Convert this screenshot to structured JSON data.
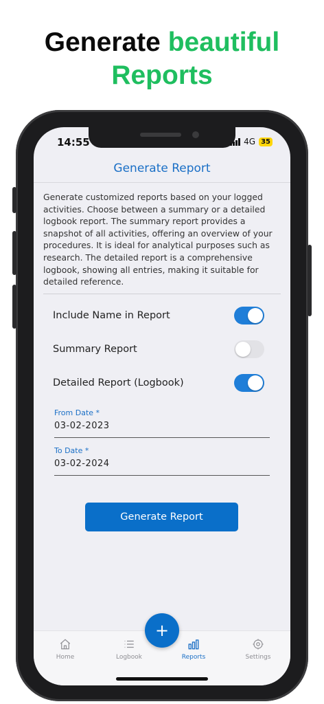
{
  "headline": {
    "line1_dark": "Generate",
    "line1_accent": "beautiful",
    "line2_accent": "Reports"
  },
  "status": {
    "time": "14:55",
    "network": "4G",
    "battery": "35"
  },
  "header": {
    "title": "Generate Report"
  },
  "description": "Generate customized reports based on your logged activities. Choose between a summary or a detailed logbook report. The summary report provides a snapshot of all activities, offering an overview of your procedures. It is ideal for analytical purposes such as research. The detailed report is a comprehensive logbook, showing all entries, making it suitable for detailed reference.",
  "toggles": [
    {
      "label": "Include Name in Report",
      "on": true
    },
    {
      "label": "Summary Report",
      "on": false
    },
    {
      "label": "Detailed Report (Logbook)",
      "on": true
    }
  ],
  "fields": {
    "from": {
      "label": "From Date *",
      "value": "03-02-2023"
    },
    "to": {
      "label": "To Date *",
      "value": "03-02-2024"
    }
  },
  "button": {
    "label": "Generate Report"
  },
  "fab": {
    "label": "+"
  },
  "tabs": [
    {
      "label": "Home",
      "icon": "home-icon",
      "active": false
    },
    {
      "label": "Logbook",
      "icon": "list-icon",
      "active": false
    },
    {
      "label": "Reports",
      "icon": "bar-chart-icon",
      "active": true
    },
    {
      "label": "Settings",
      "icon": "gear-icon",
      "active": false
    }
  ],
  "colors": {
    "accent": "#1a6fc6",
    "headline_green": "#1fbe5f",
    "button": "#0a6fc9",
    "toggle_on": "#1f7ed8"
  }
}
